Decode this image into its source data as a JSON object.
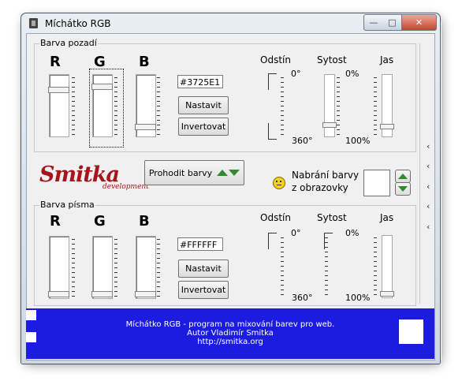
{
  "window": {
    "title": "Míchátko RGB",
    "minimize_glyph": "—",
    "maximize_glyph": "□",
    "close_glyph": "✕"
  },
  "background_group": {
    "legend": "Barva pozadí",
    "channels": [
      {
        "letter": "R",
        "value_fraction": 0.22
      },
      {
        "letter": "G",
        "value_fraction": 0.15
      },
      {
        "letter": "B",
        "value_fraction": 0.88
      }
    ],
    "hex_value": "#3725E1",
    "set_button": "Nastavit",
    "invert_button": "Invertovat",
    "hsv_headers": {
      "hue": "Odstín",
      "saturation": "Sytost",
      "brightness": "Jas"
    },
    "hue_top": "0°",
    "hue_bottom": "360°",
    "sat_top": "0%",
    "sat_bottom": "100%",
    "hue_fraction": 0.72,
    "sat_fraction": 0.85,
    "brightness_fraction": 0.88
  },
  "middle": {
    "logo_text": "Smitka",
    "logo_sub": "development",
    "swap_button": "Prohodit barvy",
    "pick_label_line1": "Nabrání barvy",
    "pick_label_line2": "z obrazovky"
  },
  "text_group": {
    "legend": "Barva písma",
    "channels": [
      {
        "letter": "R",
        "value_fraction": 0.98
      },
      {
        "letter": "G",
        "value_fraction": 0.98
      },
      {
        "letter": "B",
        "value_fraction": 0.98
      }
    ],
    "hex_value": "#FFFFFF",
    "set_button": "Nastavit",
    "invert_button": "Invertovat",
    "hsv_headers": {
      "hue": "Odstín",
      "saturation": "Sytost",
      "brightness": "Jas"
    },
    "hue_top": "0°",
    "hue_bottom": "360°",
    "sat_top": "0%",
    "sat_bottom": "100%",
    "brightness_fraction": 0.98
  },
  "footer": {
    "line1": "Míchátko RGB - program na mixování barev pro web.",
    "line2": "Autor Vladimír Smitka",
    "line3": "http://smitka.org",
    "preview_bg": "#3725E1"
  },
  "side_chevrons": [
    "‹",
    "‹",
    "‹",
    "‹",
    "‹"
  ]
}
